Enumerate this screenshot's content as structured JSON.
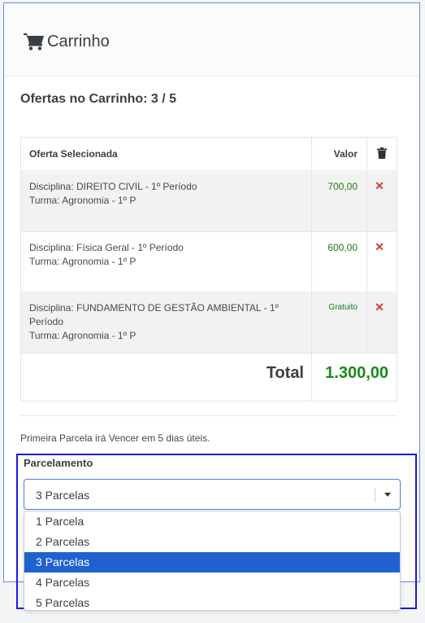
{
  "header": {
    "title": "Carrinho",
    "icon": "shopping-cart-icon"
  },
  "offers_count": "Ofertas no Carrinho: 3 / 5",
  "table": {
    "col_offer": "Oferta Selecionada",
    "col_value": "Valor",
    "col_remove_icon": "trash-icon",
    "rows": [
      {
        "line1": "Disciplina: DIREITO CIVIL - 1º Período",
        "line2": "Turma: Agronomia - 1º P",
        "price": "700,00"
      },
      {
        "line1": "Disciplina: Física Geral - 1º Período",
        "line2": "Turma: Agronomia - 1º P",
        "price": "600,00"
      },
      {
        "line1": "Disciplina: FUNDAMENTO DE GESTÃO AMBIENTAL - 1º",
        "line1b": "Período",
        "line2": "Turma: Agronomia - 1º P",
        "price": "Gratuito"
      }
    ],
    "remove_symbol": "✕",
    "total_label": "Total",
    "total_value": "1.300,00"
  },
  "due_note": "Primeira Parcela irá Vencer em 5 dias úteis.",
  "installments": {
    "label": "Parcelamento",
    "selected": "3 Parcelas",
    "options": [
      "1 Parcela",
      "2 Parcelas",
      "3 Parcelas",
      "4 Parcelas",
      "5 Parcelas"
    ]
  },
  "colors": {
    "accent": "#1f62cf",
    "price_green": "#1f7a1f",
    "remove_red": "#d63b3b"
  }
}
